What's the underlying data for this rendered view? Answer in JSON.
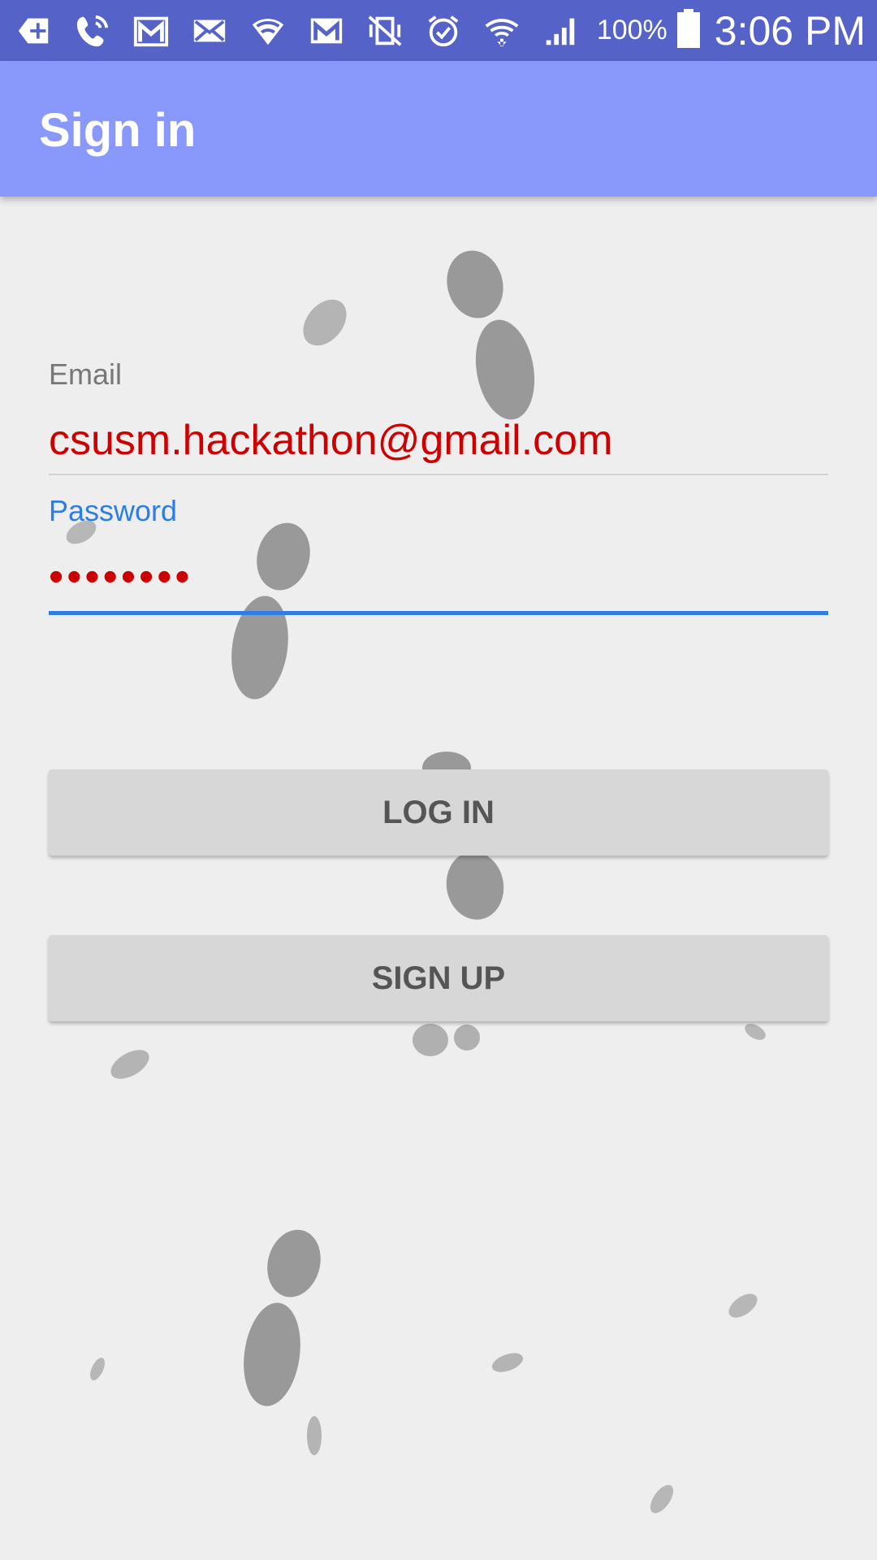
{
  "status_bar": {
    "battery": "100%",
    "time": "3:06 PM"
  },
  "app_bar": {
    "title": "Sign in"
  },
  "form": {
    "email": {
      "label": "Email",
      "value": "csusm.hackathon@gmail.com"
    },
    "password": {
      "label": "Password",
      "value": "••••••••"
    }
  },
  "buttons": {
    "login": "LOG IN",
    "signup": "SIGN UP"
  },
  "colors": {
    "status_bar": "#5563c8",
    "app_bar": "#8898fb",
    "accent": "#2d7de6",
    "input_text": "#cc0000",
    "background": "#eeeeef",
    "button": "#d7d7d7"
  }
}
